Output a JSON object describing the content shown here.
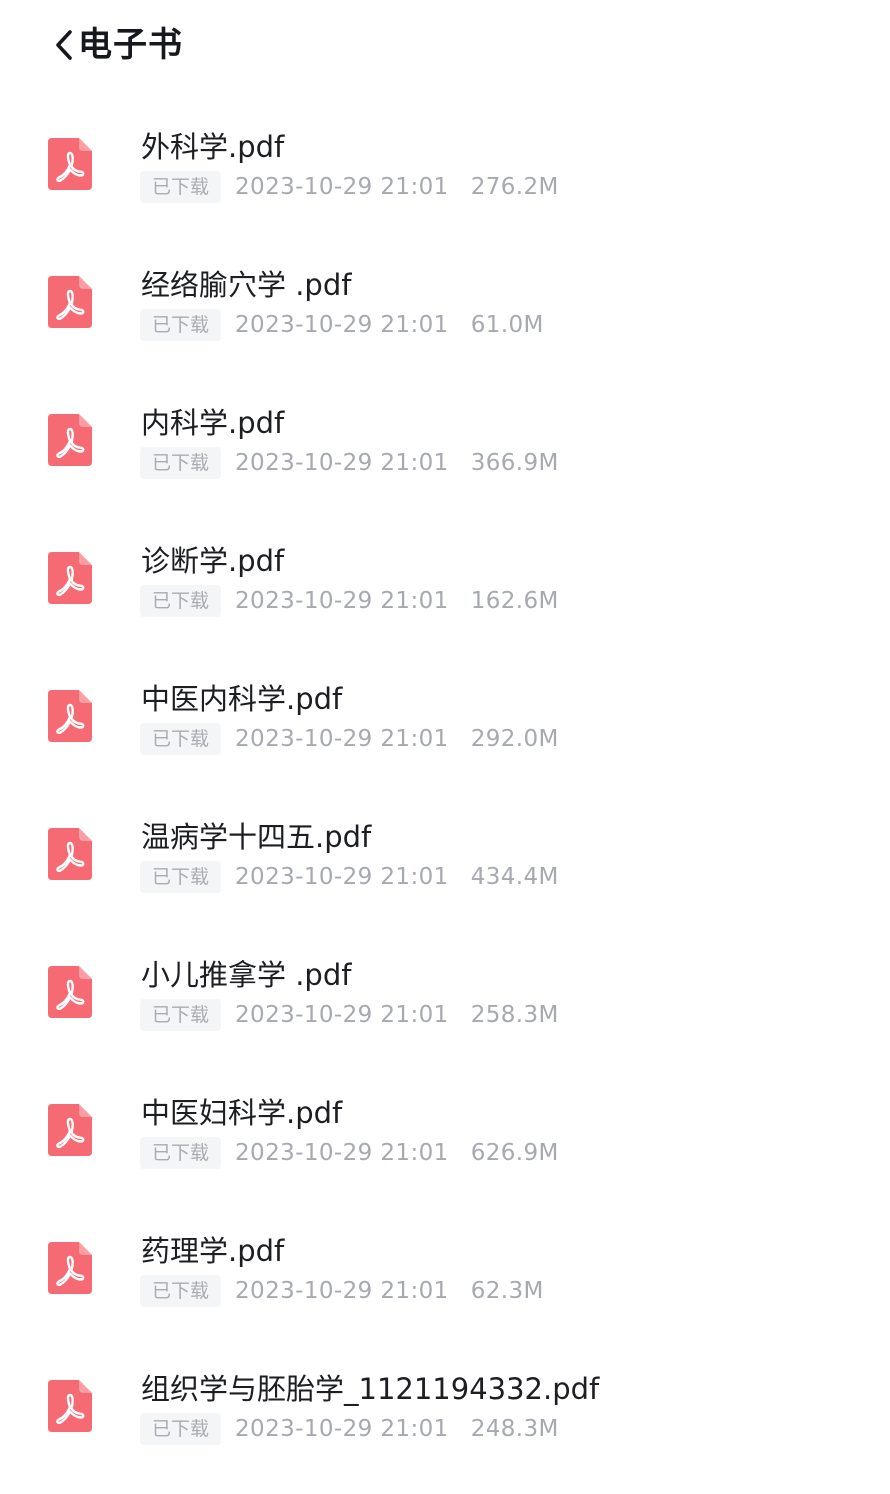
{
  "header": {
    "title": "电子书",
    "back_icon": "chevron-left-icon"
  },
  "colors": {
    "pdf_icon": "#f56a73",
    "title_text": "#1c1e22",
    "meta_text": "#a6a9b0",
    "badge_bg": "#f4f5f7"
  },
  "files": [
    {
      "name": "外科学.pdf",
      "status": "已下载",
      "date": "2023-10-29 21:01",
      "size": "276.2M",
      "icon": "pdf-icon"
    },
    {
      "name": "经络腧穴学 .pdf",
      "status": "已下载",
      "date": "2023-10-29 21:01",
      "size": "61.0M",
      "icon": "pdf-icon"
    },
    {
      "name": "内科学.pdf",
      "status": "已下载",
      "date": "2023-10-29 21:01",
      "size": "366.9M",
      "icon": "pdf-icon"
    },
    {
      "name": "诊断学.pdf",
      "status": "已下载",
      "date": "2023-10-29 21:01",
      "size": "162.6M",
      "icon": "pdf-icon"
    },
    {
      "name": "中医内科学.pdf",
      "status": "已下载",
      "date": "2023-10-29 21:01",
      "size": "292.0M",
      "icon": "pdf-icon"
    },
    {
      "name": "温病学十四五.pdf",
      "status": "已下载",
      "date": "2023-10-29 21:01",
      "size": "434.4M",
      "icon": "pdf-icon"
    },
    {
      "name": "小儿推拿学 .pdf",
      "status": "已下载",
      "date": "2023-10-29 21:01",
      "size": "258.3M",
      "icon": "pdf-icon"
    },
    {
      "name": "中医妇科学.pdf",
      "status": "已下载",
      "date": "2023-10-29 21:01",
      "size": "626.9M",
      "icon": "pdf-icon"
    },
    {
      "name": "药理学.pdf",
      "status": "已下载",
      "date": "2023-10-29 21:01",
      "size": "62.3M",
      "icon": "pdf-icon"
    },
    {
      "name": "组织学与胚胎学_1121194332.pdf",
      "status": "已下载",
      "date": "2023-10-29 21:01",
      "size": "248.3M",
      "icon": "pdf-icon"
    }
  ]
}
